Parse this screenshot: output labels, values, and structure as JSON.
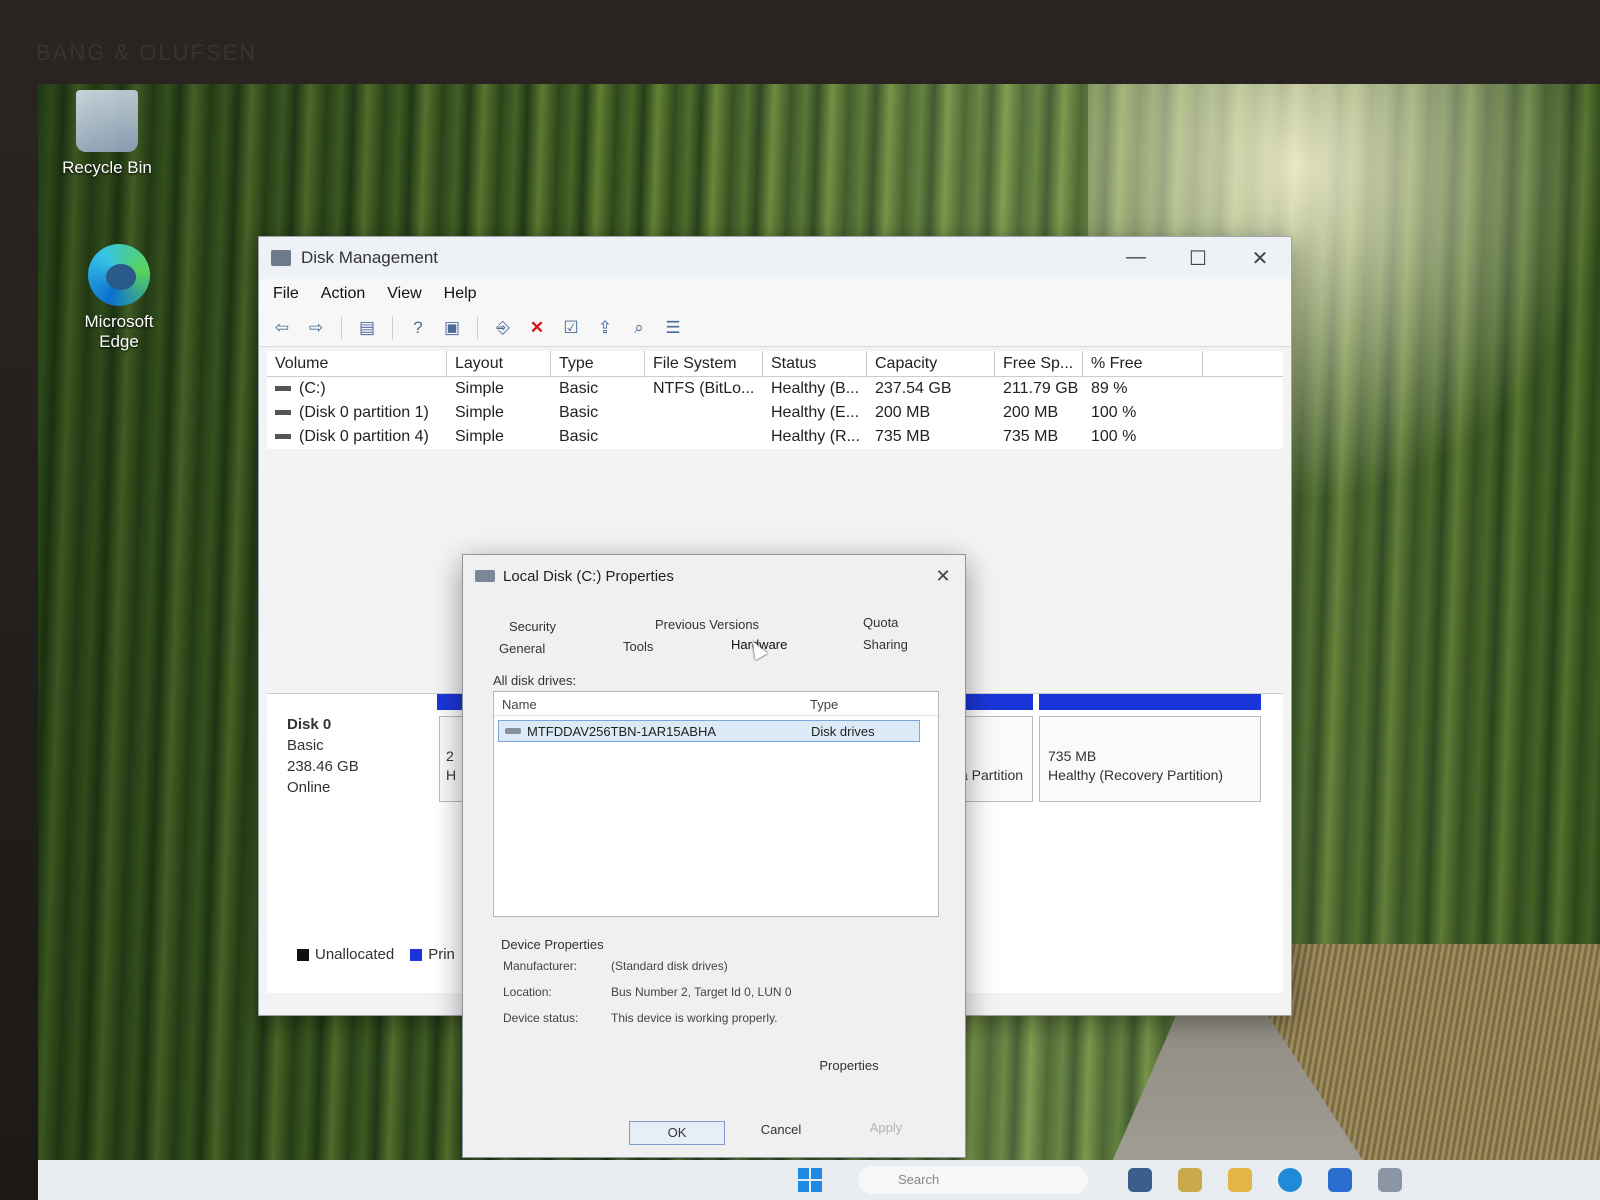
{
  "monitor": {
    "brand": "BANG & OLUFSEN"
  },
  "desktop": {
    "icons": [
      {
        "label": "Recycle Bin"
      },
      {
        "label": "Microsoft Edge"
      }
    ]
  },
  "window": {
    "title": "Disk Management",
    "controls": {
      "minimize": "—",
      "maximize": "☐",
      "close": "✕"
    },
    "menu": [
      "File",
      "Action",
      "View",
      "Help"
    ],
    "toolbar_icons": [
      "back-icon",
      "forward-icon",
      "console-tree-icon",
      "help-icon",
      "show-hide-icon",
      "connect-icon",
      "delete-icon",
      "check-icon",
      "export-icon",
      "search-icon",
      "properties-icon"
    ]
  },
  "volumes": {
    "headers": [
      "Volume",
      "Layout",
      "Type",
      "File System",
      "Status",
      "Capacity",
      "Free Sp...",
      "% Free"
    ],
    "rows": [
      [
        "(C:)",
        "Simple",
        "Basic",
        "NTFS (BitLo...",
        "Healthy (B...",
        "237.54 GB",
        "211.79 GB",
        "89 %"
      ],
      [
        "(Disk 0 partition 1)",
        "Simple",
        "Basic",
        "",
        "Healthy (E...",
        "200 MB",
        "200 MB",
        "100 %"
      ],
      [
        "(Disk 0 partition 4)",
        "Simple",
        "Basic",
        "",
        "Healthy (R...",
        "735 MB",
        "735 MB",
        "100 %"
      ]
    ]
  },
  "disk0": {
    "name": "Disk 0",
    "type": "Basic",
    "size": "238.46 GB",
    "status": "Online",
    "partition_left": {
      "line1": "2",
      "line2": "H"
    },
    "partition_mid": {
      "line2": "a Partition"
    },
    "partition_right": {
      "size": "735 MB",
      "status": "Healthy (Recovery Partition)"
    }
  },
  "legend": {
    "unallocated": "Unallocated",
    "primary": "Prin"
  },
  "dialog": {
    "title": "Local Disk (C:) Properties",
    "close": "✕",
    "tabs_row1": [
      "Security",
      "Previous Versions",
      "Quota"
    ],
    "tabs_row2": [
      "General",
      "Tools",
      "Hardware",
      "Sharing"
    ],
    "all_drives_label": "All disk drives:",
    "list_headers": {
      "name": "Name",
      "type": "Type"
    },
    "drive": {
      "name": "MTFDDAV256TBN-1AR15ABHA",
      "type": "Disk drives"
    },
    "device_properties_label": "Device Properties",
    "props": [
      {
        "key": "Manufacturer:",
        "value": "(Standard disk drives)"
      },
      {
        "key": "Location:",
        "value": "Bus Number 2, Target Id 0, LUN 0"
      },
      {
        "key": "Device status:",
        "value": "This device is working properly."
      }
    ],
    "properties_button": "Properties",
    "ok": "OK",
    "cancel": "Cancel",
    "apply": "Apply"
  },
  "taskbar": {
    "search_placeholder": "Search"
  }
}
